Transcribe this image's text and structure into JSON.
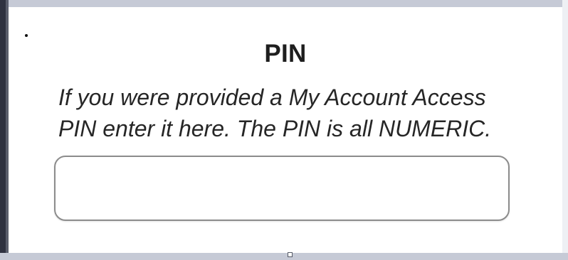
{
  "form": {
    "title": "PIN",
    "description_line_1": "If you were provided a My Account Access",
    "description_line_2": "PIN enter it here. The PIN is all NUMERIC.",
    "pin_value": "",
    "pin_placeholder": ""
  },
  "colors": {
    "background": "#ffffff",
    "text": "#262626",
    "input_border": "#8c8c8c",
    "frame": "#c6cad6"
  }
}
